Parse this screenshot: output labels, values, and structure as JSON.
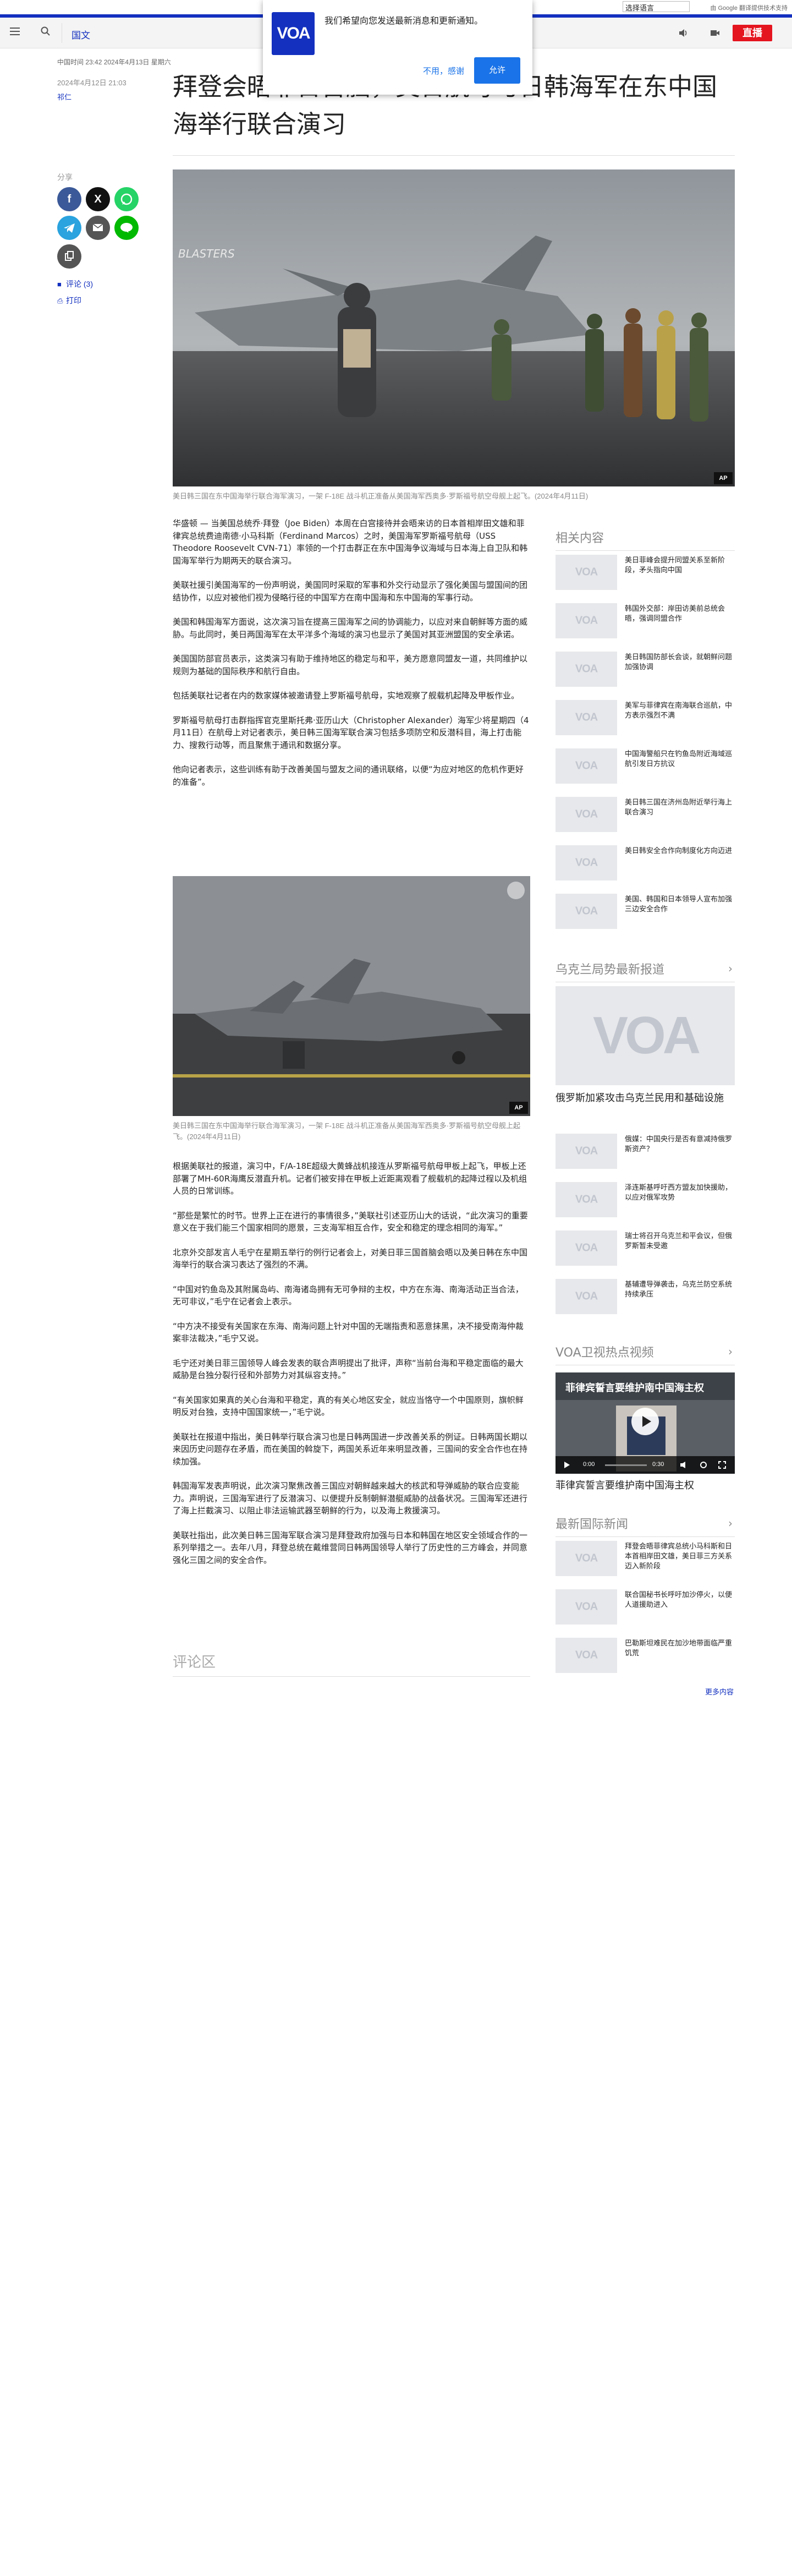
{
  "util": {
    "language_select": "选择语言",
    "translate_note": "由 Google 翻译提供技术支持"
  },
  "header": {
    "section": "国文",
    "live_label": "直播"
  },
  "popup": {
    "logo": "VOA",
    "message": "我们希望向您发送最新消息和更新通知。",
    "decline": "不用，感谢",
    "accept": "允许"
  },
  "article": {
    "breadcrumb": "中国时间 23:42 2024年4月13日 星期六",
    "title": "拜登会晤菲日首脑，美日航母与日韩海军在东中国海举行联合演习",
    "date": "2024年4月12日 21:03",
    "author": "祁仁",
    "share_label": "分享",
    "comments_link": "评论 (3)",
    "print_link": "打印",
    "caption1": "美日韩三国在东中国海举行联合海军演习，一架 F-18E 战斗机正准备从美国海军西奥多·罗斯福号航空母舰上起飞。(2024年4月11日)",
    "caption2": "美日韩三国在东中国海举行联合海军演习，一架 F-18E 战斗机正准备从美国海军西奥多·罗斯福号航空母舰上起飞。(2024年4月11日)",
    "paragraphs_a": [
      "华盛顿 — 当美国总统乔·拜登（Joe Biden）本周在白宫接待并会晤来访的日本首相岸田文雄和菲律宾总统费迪南德·小马科斯（Ferdinand Marcos）之时，美国海军罗斯福号航母（USS Theodore Roosevelt CVN-71）率领的一个打击群正在东中国海争议海域与日本海上自卫队和韩国海军举行为期两天的联合演习。",
      "美联社援引美国海军的一份声明说，美国同时采取的军事和外交行动显示了强化美国与盟国间的团结协作，以应对被他们视为侵略行径的中国军方在南中国海和东中国海的军事行动。",
      "美国和韩国海军方面说，这次演习旨在提高三国海军之间的协调能力，以应对来自朝鲜等方面的威胁。与此同时，美日两国海军在太平洋多个海域的演习也显示了美国对其亚洲盟国的安全承诺。",
      "美国国防部官员表示，这类演习有助于维持地区的稳定与和平，美方愿意同盟友一道，共同维护以规则为基础的国际秩序和航行自由。",
      "包括美联社记者在内的数家媒体被邀请登上罗斯福号航母，实地观察了舰载机起降及甲板作业。",
      "罗斯福号航母打击群指挥官克里斯托弗·亚历山大（Christopher Alexander）海军少将星期四（4月11日）在航母上对记者表示，美日韩三国海军联合演习包括多项防空和反潜科目，海上打击能力、搜救行动等，而且聚焦于通讯和数据分享。",
      "他向记者表示，这些训练有助于改善美国与盟友之间的通讯联络，以便“为应对地区的危机作更好的准备”。"
    ],
    "paragraphs_b": [
      "根据美联社的报道，演习中，F/A-18E超级大黄蜂战机接连从罗斯福号航母甲板上起飞，甲板上还部署了MH-60R海鹰反潜直升机。记者们被安排在甲板上近距离观看了舰载机的起降过程以及机组人员的日常训练。",
      "“那些是繁忙的时节。世界上正在进行的事情很多，”美联社引述亚历山大的话说，“此次演习的重要意义在于我们能三个国家相同的愿景，三支海军相互合作，安全和稳定的理念相同的海军。”",
      "北京外交部发言人毛宁在星期五举行的例行记者会上，对美日菲三国首脑会晤以及美日韩在东中国海举行的联合演习表达了强烈的不满。",
      "“中国对钓鱼岛及其附属岛屿、南海诸岛拥有无可争辩的主权，中方在东海、南海活动正当合法，无可非议，”毛宁在记者会上表示。",
      "“中方决不接受有关国家在东海、南海问题上针对中国的无端指责和恶意抹黑，决不接受南海仲裁案非法裁决，”毛宁又说。",
      "毛宁还对美日菲三国领导人峰会发表的联合声明提出了批评，声称“当前台海和平稳定面临的最大威胁是台独分裂行径和外部势力对其纵容支持。”",
      "“有关国家如果真的关心台海和平稳定，真的有关心地区安全，就应当恪守一个中国原则，旗帜鲜明反对台独，支持中国国家统一，”毛宁说。",
      "美联社在报道中指出，美日韩举行联合演习也是日韩两国进一步改善关系的例证。日韩两国长期以来因历史问题存在矛盾，而在美国的斡旋下，两国关系近年来明显改善，三国间的安全合作也在持续加强。",
      "韩国海军发表声明说，此次演习聚焦改善三国应对朝鲜越来越大的核武和导弹威胁的联合应变能力。声明说，三国海军进行了反潜演习、以便提升反制朝鲜潜艇威胁的战备状况。三国海军还进行了海上拦截演习、以阻止非法运输武器至朝鲜的行为，以及海上救援演习。",
      "美联社指出，此次美日韩三国海军联合演习是拜登政府加强与日本和韩国在地区安全领域合作的一系列举措之一。去年八月，拜登总统在戴维营同日韩两国领导人举行了历史性的三方峰会，并同意强化三国之间的安全合作。"
    ]
  },
  "comments": {
    "heading": "评论区"
  },
  "rail": {
    "related_heading": "相关内容",
    "related": [
      {
        "thumb": "VOA",
        "title": "美日菲峰会提升同盟关系至新阶段，矛头指向中国"
      },
      {
        "thumb": "VOA",
        "title": "韩国外交部：岸田访美前总统会晤，强调同盟合作"
      },
      {
        "thumb": "VOA",
        "title": "美日韩国防部长会谈，就朝鲜问题加强协调"
      },
      {
        "thumb": "VOA",
        "title": "美军与菲律宾在南海联合巡航，中方表示强烈不满"
      },
      {
        "thumb": "VOA",
        "title": "中国海警船只在钓鱼岛附近海域巡航引发日方抗议"
      },
      {
        "thumb": "VOA",
        "title": "美日韩三国在济州岛附近举行海上联合演习"
      },
      {
        "thumb": "VOA",
        "title": "美日韩安全合作向制度化方向迈进"
      },
      {
        "thumb": "VOA",
        "title": "美国、韩国和日本领导人宣布加强三边安全合作"
      }
    ],
    "ukraine_heading": "乌克兰局势最新报道",
    "ukraine_big_title": "俄罗斯加紧攻击乌克兰民用和基础设施",
    "ukraine_items": [
      {
        "thumb": "VOA",
        "title": "俄媒：中国央行是否有意减持俄罗斯资产？"
      },
      {
        "thumb": "VOA",
        "title": "泽连斯基呼吁西方盟友加快援助，以应对俄军攻势"
      },
      {
        "thumb": "VOA",
        "title": "瑞士将召开乌克兰和平会议，但俄罗斯暂未受邀"
      },
      {
        "thumb": "VOA",
        "title": "基辅遭导弹袭击，乌克兰防空系统持续承压"
      }
    ],
    "video_heading": "VOA卫视热点视频",
    "video": {
      "title": "菲律宾誓言要维护南中国海主权",
      "time": "0:00",
      "duration": "0:30"
    },
    "video_caption": "菲律宾誓言要维护南中国海主权",
    "news_heading": "最新国际新闻",
    "news_items": [
      {
        "thumb": "VOA",
        "title": "拜登会晤菲律宾总统小马科斯和日本首相岸田文雄，美日菲三方关系迈入新阶段"
      },
      {
        "thumb": "VOA",
        "title": "联合国秘书长呼吁加沙停火，以便人道援助进入"
      },
      {
        "thumb": "VOA",
        "title": "巴勒斯坦难民在加沙地带面临严重饥荒"
      }
    ],
    "more": "更多内容"
  }
}
